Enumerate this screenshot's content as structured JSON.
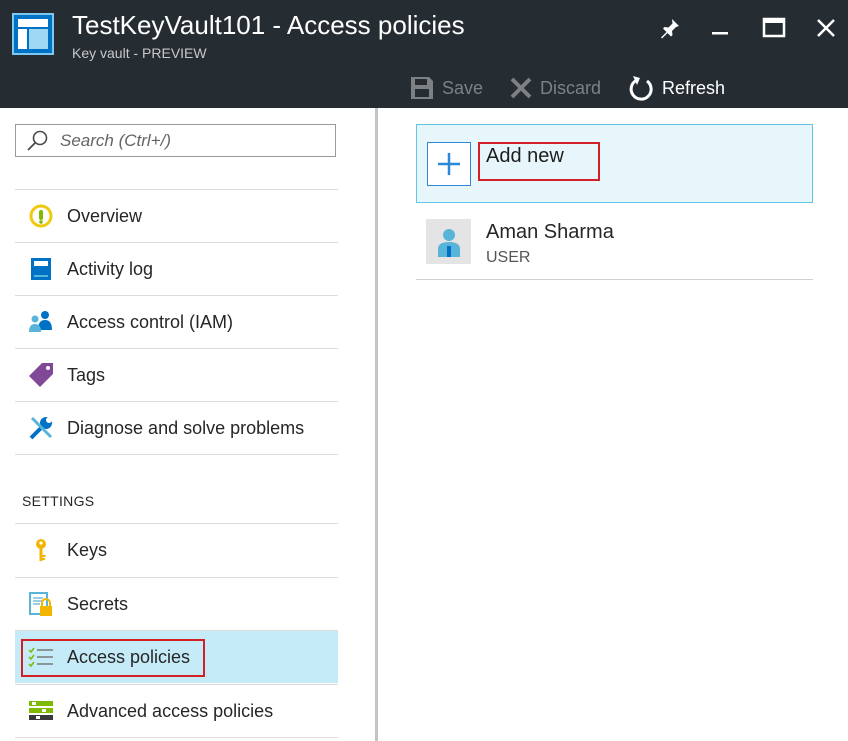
{
  "window": {
    "title": "TestKeyVault101 - Access policies",
    "subtitle": "Key vault - PREVIEW",
    "controls": [
      "pin-icon",
      "minimize-icon",
      "maximize-icon",
      "close-icon"
    ]
  },
  "toolbar": {
    "save_label": "Save",
    "discard_label": "Discard",
    "refresh_label": "Refresh"
  },
  "search": {
    "placeholder": "Search (Ctrl+/)"
  },
  "sidebar": {
    "items": [
      {
        "label": "Overview",
        "icon": "overview-icon"
      },
      {
        "label": "Activity log",
        "icon": "activity-log-icon"
      },
      {
        "label": "Access control (IAM)",
        "icon": "access-control-icon"
      },
      {
        "label": "Tags",
        "icon": "tag-icon"
      },
      {
        "label": "Diagnose and solve problems",
        "icon": "wrench-icon"
      }
    ],
    "section_title": "SETTINGS",
    "settings_items": [
      {
        "label": "Keys",
        "icon": "key-icon"
      },
      {
        "label": "Secrets",
        "icon": "secret-icon"
      },
      {
        "label": "Access policies",
        "icon": "access-policies-icon",
        "active": true
      },
      {
        "label": "Advanced access policies",
        "icon": "advanced-policies-icon"
      }
    ]
  },
  "main": {
    "add_new_label": "Add new",
    "users": [
      {
        "name": "Aman Sharma",
        "type": "USER"
      }
    ]
  },
  "colors": {
    "header_bg": "#252d32",
    "active_item_bg": "#c4ebf7",
    "add_new_bg": "#e6f6fb",
    "accent_blue": "#2b88d8",
    "highlight_red": "#d32027"
  }
}
